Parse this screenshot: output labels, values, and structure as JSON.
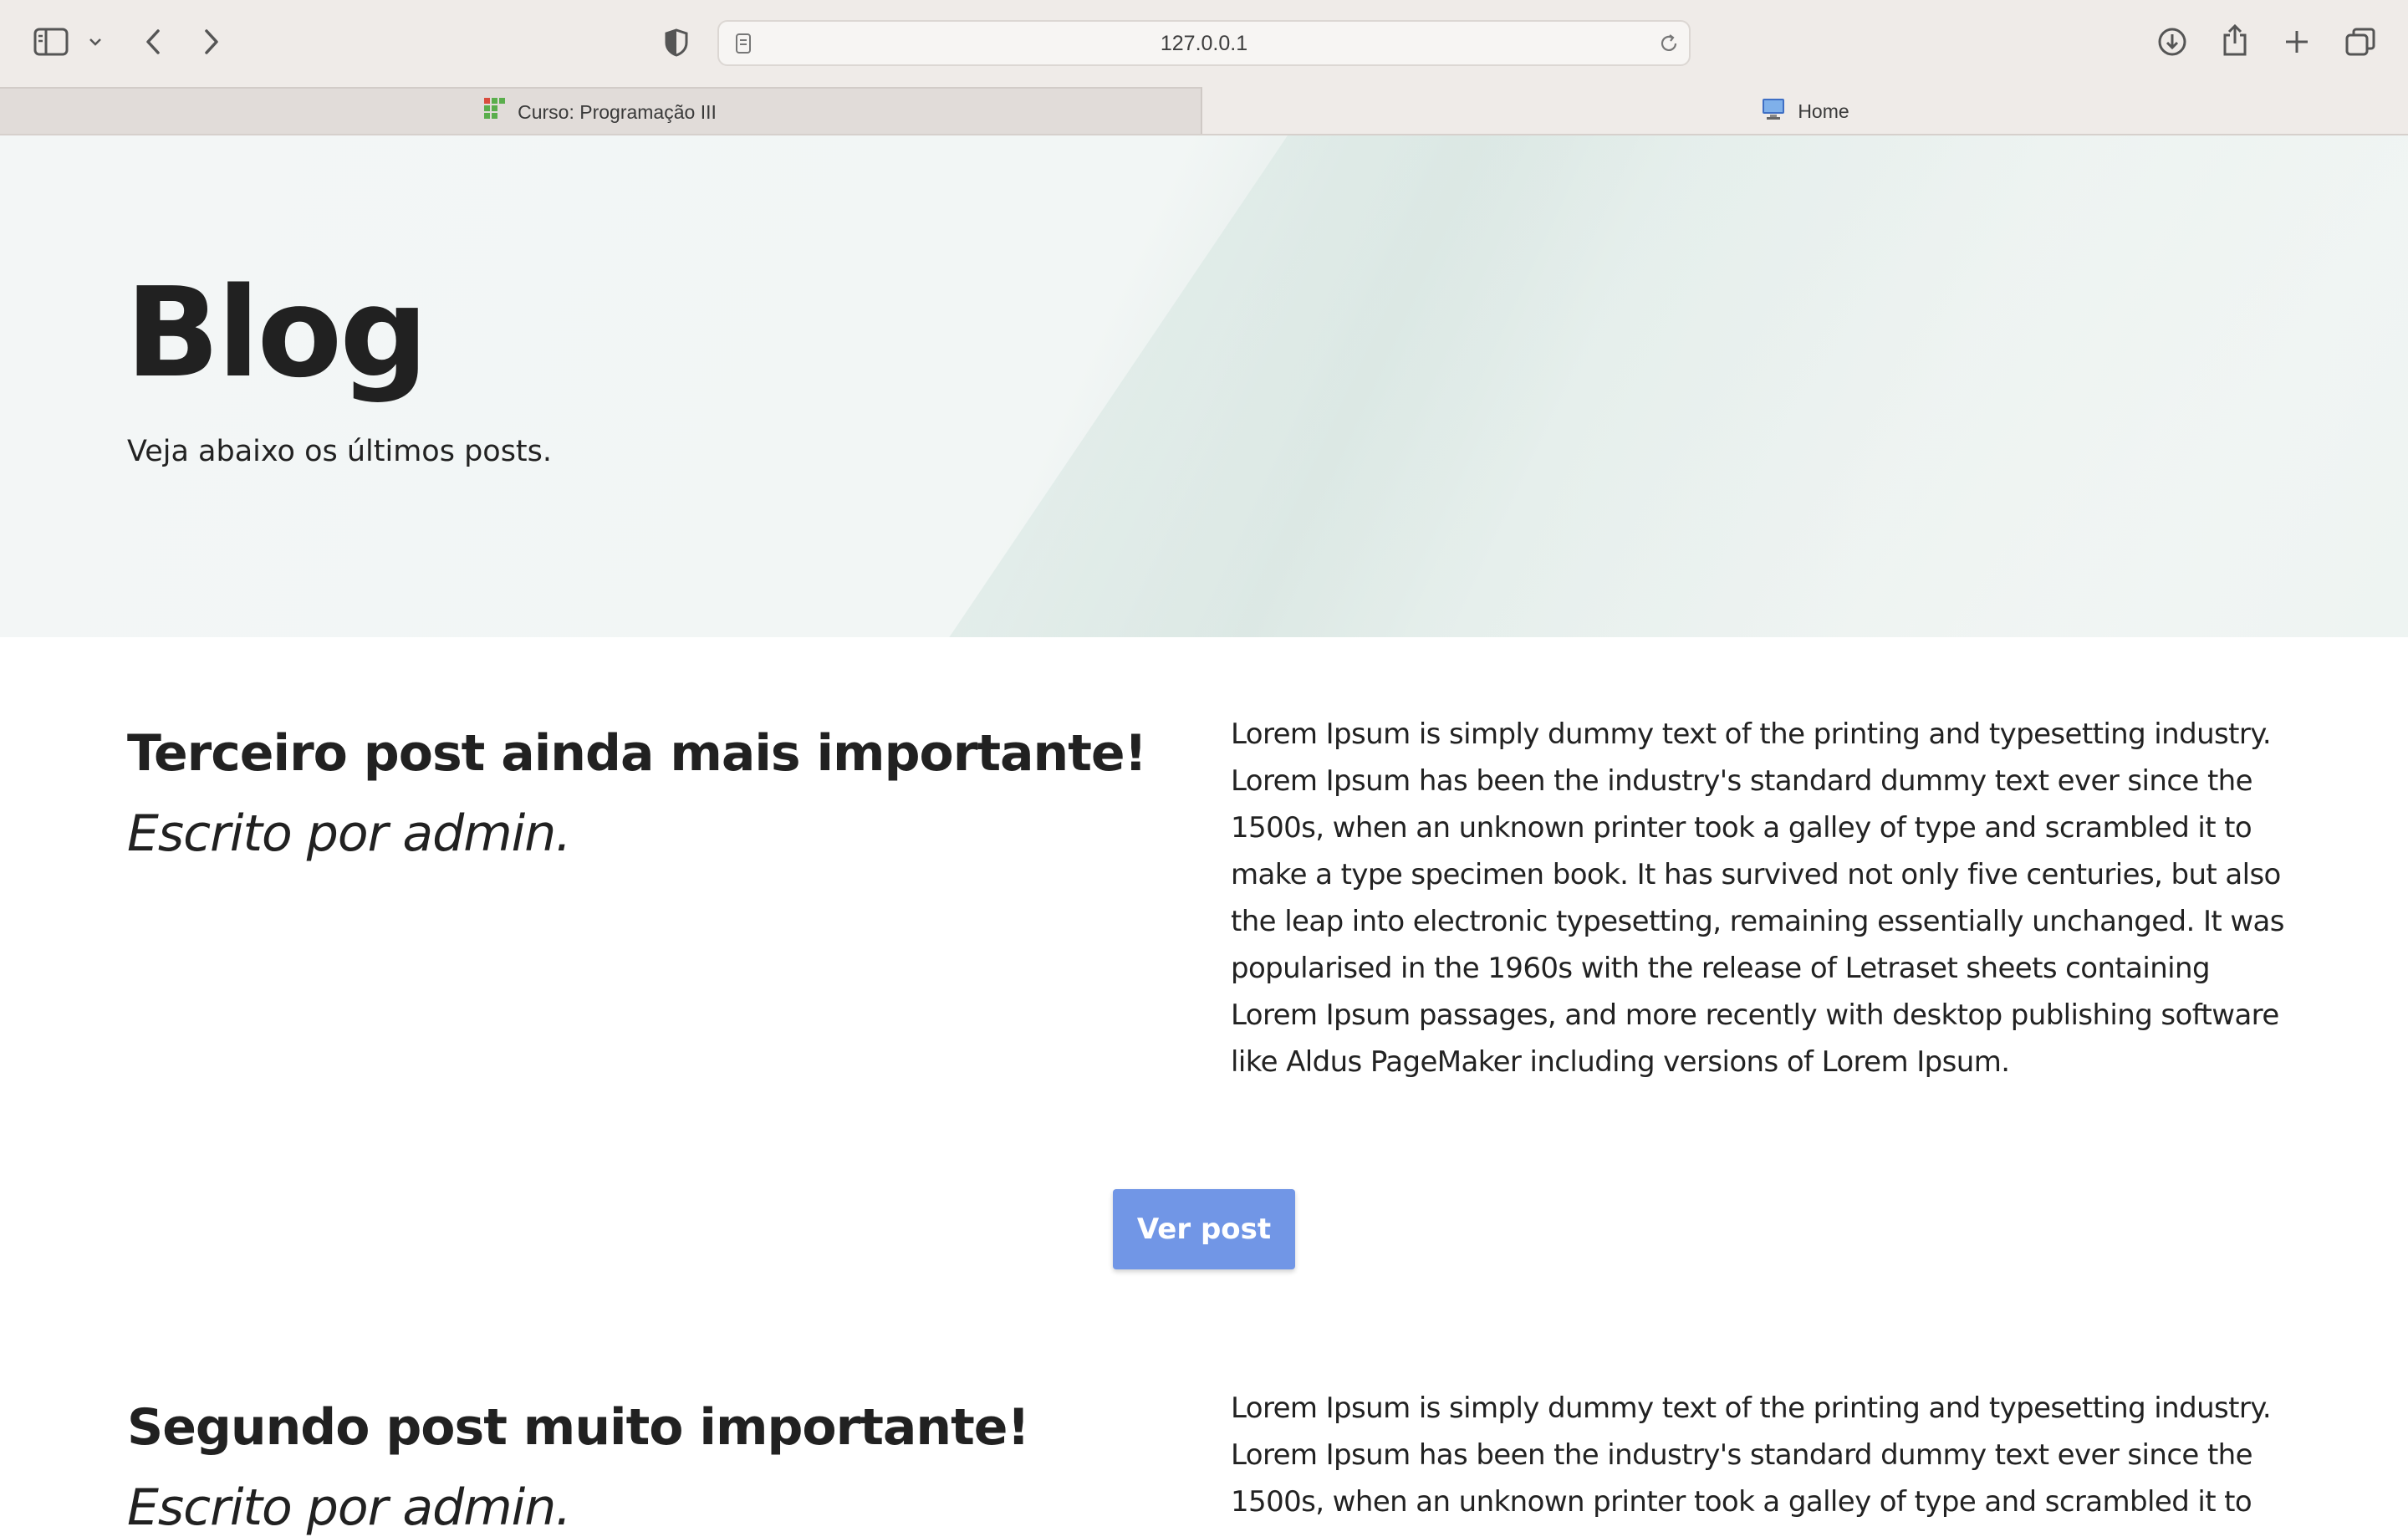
{
  "browser": {
    "url": "127.0.0.1",
    "tabs": [
      {
        "label": "Curso: Programação III",
        "active": false,
        "icon": "grid-favicon"
      },
      {
        "label": "Home",
        "active": true,
        "icon": "monitor-favicon"
      }
    ]
  },
  "hero": {
    "title": "Blog",
    "subtitle": "Veja abaixo os últimos posts."
  },
  "posts": [
    {
      "title": "Terceiro post ainda mais importante!",
      "author": "Escrito por admin.",
      "body": "Lorem Ipsum is simply dummy text of the printing and typesetting industry. Lorem Ipsum has been the industry's standard dummy text ever since the 1500s, when an unknown printer took a galley of type and scrambled it to make a type specimen book. It has survived not only five centuries, but also the leap into electronic typesetting, remaining essentially unchanged. It was popularised in the 1960s with the release of Letraset sheets containing Lorem Ipsum passages, and more recently with desktop publishing software like Aldus PageMaker including versions of Lorem Ipsum.",
      "button": "Ver post"
    },
    {
      "title": "Segundo post muito importante!",
      "author": "Escrito por admin.",
      "body": "Lorem Ipsum is simply dummy text of the printing and typesetting industry. Lorem Ipsum has been the industry's standard dummy text ever since the 1500s, when an unknown printer took a galley of type and scrambled it to"
    }
  ],
  "colors": {
    "button": "#7196e6",
    "chrome": "#efebe8",
    "text": "#212121"
  }
}
